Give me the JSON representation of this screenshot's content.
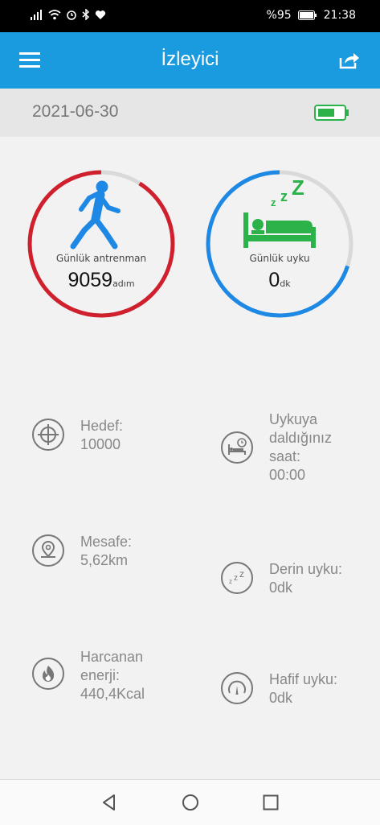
{
  "status_bar": {
    "battery": "%95",
    "time": "21:38"
  },
  "app_bar": {
    "title": "İzleyici",
    "menu_icon": "hamburger-menu-icon",
    "share_icon": "share-icon"
  },
  "date_bar": {
    "date": "2021-06-30",
    "battery_icon": "battery-icon"
  },
  "rings": {
    "training": {
      "label": "Günlük antrenman",
      "value": "9059",
      "unit": "adım",
      "progress": 0.91,
      "color": "#d0202e",
      "icon": "runner-icon"
    },
    "sleep": {
      "label": "Günlük uyku",
      "value": "0",
      "unit": "dk",
      "progress": 0.7,
      "color": "#1e88e5",
      "icon": "sleeping-bed-icon"
    }
  },
  "stats": {
    "goal": {
      "label": "Hedef:",
      "value": "10000",
      "icon": "target-icon"
    },
    "distance": {
      "label": "Mesafe:",
      "value": "5,62km",
      "icon": "location-pin-icon"
    },
    "energy": {
      "label_line1": "Harcanan",
      "label_line2": "enerji:",
      "value": "440,4Kcal",
      "icon": "flame-icon"
    },
    "sleep_time": {
      "line1": "Uykuya",
      "line2": "daldığınız",
      "line3": "saat:",
      "value": "00:00",
      "icon": "bed-clock-icon"
    },
    "deep_sleep": {
      "label": "Derin uyku:",
      "value": "0dk",
      "icon": "zzz-icon"
    },
    "light_sleep": {
      "label": "Hafif uyku:",
      "value": "0dk",
      "icon": "gauge-icon"
    }
  },
  "colors": {
    "app_bar": "#1a9be0",
    "ring_track": "#d9d9d9",
    "battery_green": "#2bb34a"
  }
}
